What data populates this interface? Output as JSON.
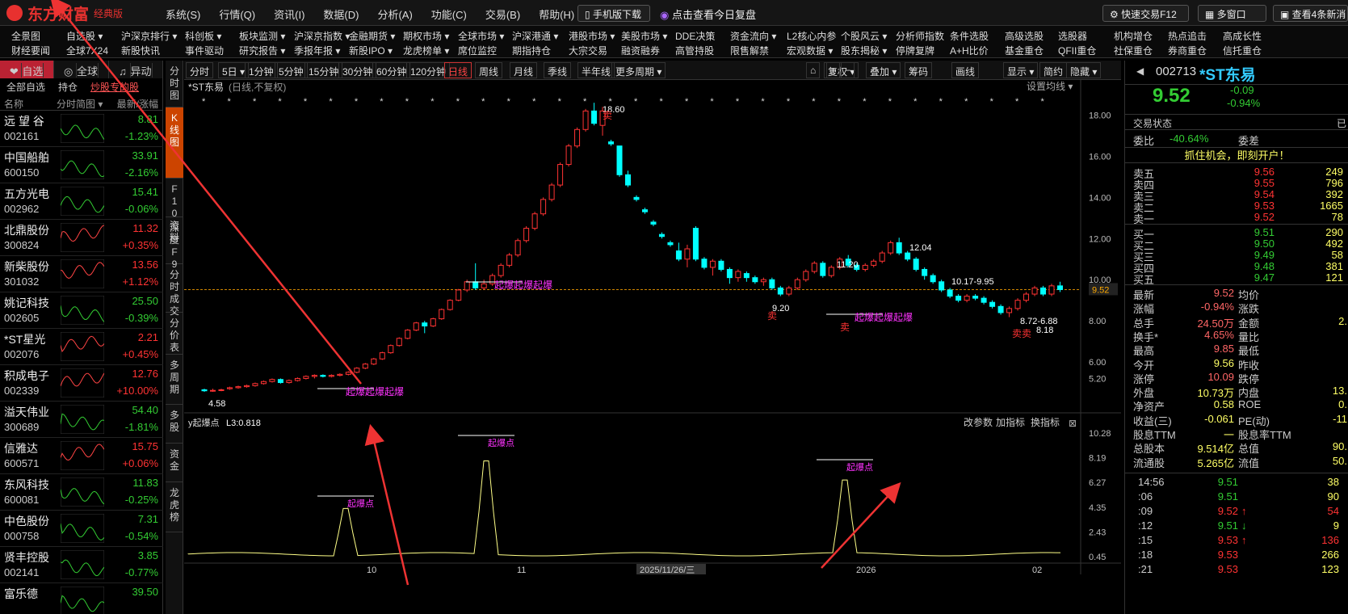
{
  "app": {
    "logo_text": "东方财富",
    "edition": "经典版",
    "menus": [
      "系统(S)",
      "行情(Q)",
      "资讯(I)",
      "数据(D)",
      "分析(A)",
      "功能(C)",
      "交易(B)",
      "帮助(H)"
    ],
    "mobile_download": "手机版下载",
    "review": "点击查看今日复盘",
    "fast_trade": "快速交易F12",
    "multi_window": "多窗口",
    "news_btn": "查看4条新消"
  },
  "menu2": {
    "row1": [
      "全景图",
      "自选股 ▾",
      "沪深京排行 ▾",
      "科创板 ▾",
      "板块监测 ▾",
      "沪深京指数 ▾",
      "金融期货 ▾",
      "期权市场 ▾",
      "全球市场 ▾",
      "沪深港通 ▾",
      "港股市场 ▾",
      "美股市场 ▾",
      "DDE决策",
      "资金流向 ▾",
      "L2核心内参",
      "个股风云 ▾",
      "分析师指数",
      "条件选股",
      "高级选股",
      "选股器",
      "机构增仓",
      "热点追击",
      "高成长性"
    ],
    "row2": [
      "财经要闻",
      "全球7X24",
      "新股快讯",
      "事件驱动",
      "研究报告 ▾",
      "季报年报 ▾",
      "新股IPO ▾",
      "龙虎榜单 ▾",
      "席位监控",
      "期指持仓",
      "大宗交易",
      "融资融券",
      "高管持股",
      "限售解禁",
      "宏观数据 ▾",
      "股东揭秘 ▾",
      "停牌复牌",
      "A+H比价",
      "基金重仓",
      "QFII重仓",
      "社保重仓",
      "券商重仓",
      "信托重仓"
    ]
  },
  "left": {
    "tabs": [
      "自选",
      "全球",
      "异动"
    ],
    "subtabs": [
      "全部自选",
      "持仓",
      "炒股专的股"
    ],
    "head": [
      "名称",
      "分时简图 ▾",
      "最新/涨幅"
    ],
    "stocks": [
      {
        "name": "远 望 谷",
        "code": "002161",
        "price": "8.81",
        "pct": "-1.23%",
        "dir": "dn"
      },
      {
        "name": "中国船舶",
        "code": "600150",
        "price": "33.91",
        "pct": "-2.16%",
        "dir": "dn"
      },
      {
        "name": "五方光电",
        "code": "002962",
        "price": "15.41",
        "pct": "-0.06%",
        "dir": "dn"
      },
      {
        "name": "北鼎股份",
        "code": "300824",
        "price": "11.32",
        "pct": "+0.35%",
        "dir": "up"
      },
      {
        "name": "新柴股份",
        "code": "301032",
        "price": "13.56",
        "pct": "+1.12%",
        "dir": "up"
      },
      {
        "name": "姚记科技",
        "code": "002605",
        "price": "25.50",
        "pct": "-0.39%",
        "dir": "dn"
      },
      {
        "name": "*ST星光",
        "code": "002076",
        "price": "2.21",
        "pct": "+0.45%",
        "dir": "up"
      },
      {
        "name": "积成电子",
        "code": "002339",
        "price": "12.76",
        "pct": "+10.00%",
        "dir": "up"
      },
      {
        "name": "溢天伟业",
        "code": "300689",
        "price": "54.40",
        "pct": "-1.81%",
        "dir": "dn"
      },
      {
        "name": "信雅达",
        "code": "600571",
        "price": "15.75",
        "pct": "+0.06%",
        "dir": "up"
      },
      {
        "name": "东风科技",
        "code": "600081",
        "price": "11.83",
        "pct": "-0.25%",
        "dir": "dn"
      },
      {
        "name": "中色股份",
        "code": "000758",
        "price": "7.31",
        "pct": "-0.54%",
        "dir": "dn"
      },
      {
        "name": "贤丰控股",
        "code": "002141",
        "price": "3.85",
        "pct": "-0.77%",
        "dir": "dn"
      },
      {
        "name": "富乐德",
        "code": "",
        "price": "39.50",
        "pct": "",
        "dir": "dn"
      }
    ]
  },
  "sidetabs": [
    "分时图",
    "K线图",
    "F10资料",
    "深度F9",
    "分时成交",
    "分价表",
    "多周期",
    "多股",
    "资金",
    "龙虎榜"
  ],
  "toolbar": {
    "periods": [
      "分时",
      "5日 ▾",
      "1分钟",
      "5分钟",
      "15分钟",
      "30分钟",
      "60分钟",
      "120分钟",
      "日线",
      "周线",
      "月线",
      "季线",
      "半年线",
      "更多周期 ▾"
    ],
    "tools": [
      "复权 ▾",
      "叠加 ▾",
      "筹码",
      "画线",
      "显示 ▾",
      "简约",
      "隐藏 ▾"
    ]
  },
  "chart_data": {
    "type": "candlestick",
    "title": "*ST东易",
    "subtitle": "(日线,不复权)",
    "set_ma": "设置均线 ▾",
    "ylim": [
      4.0,
      19.0
    ],
    "yticks": [
      "18.00",
      "16.00",
      "14.00",
      "12.00",
      "10.00",
      "8.00",
      "6.00",
      "5.20"
    ],
    "current": "9.52",
    "annotations": [
      "18.60",
      "12.04",
      "11.20",
      "10.17-9.95",
      "9.20",
      "8.72-6.88",
      "8.18",
      "4.58"
    ],
    "signals": [
      "起爆起爆起爆",
      "起爆起爆起爆",
      "起爆起爆起爆"
    ],
    "buy_sell": [
      "卖",
      "卖",
      "卖卖",
      "卖"
    ],
    "candles": [
      [
        4.65,
        4.6,
        4.7,
        4.55
      ],
      [
        4.6,
        4.62,
        4.7,
        4.55
      ],
      [
        4.62,
        4.65,
        4.7,
        4.58
      ],
      [
        4.7,
        4.75,
        4.8,
        4.65
      ],
      [
        4.75,
        4.8,
        4.85,
        4.7
      ],
      [
        4.8,
        4.85,
        4.9,
        4.75
      ],
      [
        4.85,
        4.95,
        5.0,
        4.8
      ],
      [
        4.95,
        5.05,
        5.1,
        4.9
      ],
      [
        5.05,
        5.15,
        5.2,
        5.0
      ],
      [
        5.15,
        5.0,
        5.2,
        4.95
      ],
      [
        5.0,
        5.1,
        5.15,
        4.95
      ],
      [
        5.1,
        5.2,
        5.25,
        5.05
      ],
      [
        5.2,
        5.3,
        5.35,
        5.15
      ],
      [
        5.3,
        5.35,
        5.4,
        5.2
      ],
      [
        5.35,
        5.3,
        5.4,
        5.25
      ],
      [
        5.3,
        5.35,
        5.4,
        5.25
      ],
      [
        5.35,
        5.4,
        5.45,
        5.3
      ],
      [
        5.4,
        5.5,
        5.55,
        5.35
      ],
      [
        5.5,
        5.7,
        5.75,
        5.45
      ],
      [
        5.7,
        5.9,
        5.95,
        5.65
      ],
      [
        5.9,
        6.15,
        6.2,
        5.85
      ],
      [
        6.15,
        6.45,
        6.5,
        6.1
      ],
      [
        6.45,
        6.8,
        6.85,
        6.4
      ],
      [
        6.8,
        7.15,
        7.2,
        6.75
      ],
      [
        7.15,
        7.55,
        7.6,
        7.1
      ],
      [
        7.55,
        7.9,
        7.95,
        7.5
      ],
      [
        7.9,
        7.75,
        8.0,
        7.4
      ],
      [
        7.75,
        8.1,
        8.15,
        7.7
      ],
      [
        8.1,
        8.55,
        8.6,
        8.05
      ],
      [
        8.55,
        9.0,
        9.05,
        8.5
      ],
      [
        9.0,
        9.5,
        9.55,
        8.95
      ],
      [
        9.5,
        9.9,
        10.0,
        9.4
      ],
      [
        9.9,
        9.6,
        10.8,
        9.5
      ],
      [
        9.6,
        9.8,
        10.0,
        9.5
      ],
      [
        9.8,
        10.2,
        10.3,
        9.7
      ],
      [
        10.2,
        10.7,
        10.8,
        10.1
      ],
      [
        10.7,
        11.2,
        11.3,
        10.6
      ],
      [
        11.2,
        11.9,
        12.0,
        11.1
      ],
      [
        11.9,
        12.5,
        12.6,
        11.8
      ],
      [
        12.5,
        13.2,
        13.3,
        12.4
      ],
      [
        13.2,
        13.9,
        14.0,
        13.1
      ],
      [
        13.9,
        14.6,
        14.7,
        13.8
      ],
      [
        14.6,
        15.6,
        15.7,
        14.5
      ],
      [
        15.6,
        16.5,
        16.6,
        15.5
      ],
      [
        16.5,
        17.3,
        17.4,
        16.4
      ],
      [
        17.3,
        18.2,
        18.3,
        17.2
      ],
      [
        18.2,
        17.6,
        18.6,
        17.5
      ],
      [
        17.5,
        18.2,
        18.4,
        17.0
      ],
      [
        16.7,
        16.6,
        16.8,
        16.5
      ],
      [
        16.5,
        15.1,
        16.5,
        15.0
      ],
      [
        15.1,
        14.6,
        15.3,
        14.5
      ],
      [
        14.0,
        13.9,
        14.1,
        13.8
      ],
      [
        13.4,
        13.3,
        13.5,
        13.2
      ],
      [
        12.8,
        12.7,
        12.9,
        12.6
      ],
      [
        12.2,
        12.1,
        12.3,
        12.0
      ],
      [
        11.8,
        11.7,
        11.9,
        11.6
      ],
      [
        11.4,
        11.0,
        11.8,
        10.9
      ],
      [
        11.0,
        11.5,
        11.7,
        10.6
      ],
      [
        12.5,
        11.0,
        12.6,
        10.9
      ],
      [
        11.0,
        10.6,
        11.1,
        10.5
      ],
      [
        10.6,
        10.9,
        11.0,
        10.2
      ],
      [
        10.9,
        10.5,
        11.0,
        10.4
      ],
      [
        10.5,
        10.1,
        10.6,
        9.8
      ],
      [
        10.1,
        10.4,
        10.5,
        9.9
      ],
      [
        10.3,
        10.1,
        10.4,
        9.9
      ],
      [
        10.1,
        9.9,
        10.2,
        9.8
      ],
      [
        9.9,
        10.0,
        10.1,
        9.7
      ],
      [
        10.0,
        9.6,
        10.1,
        9.5
      ],
      [
        9.6,
        9.3,
        9.7,
        9.2
      ],
      [
        9.3,
        9.6,
        9.7,
        9.2
      ],
      [
        9.6,
        10.0,
        10.1,
        9.5
      ],
      [
        10.0,
        10.4,
        10.5,
        9.9
      ],
      [
        10.4,
        10.8,
        10.9,
        10.3
      ],
      [
        10.8,
        10.2,
        10.9,
        10.1
      ],
      [
        10.2,
        10.6,
        10.7,
        10.1
      ],
      [
        10.6,
        11.0,
        11.1,
        10.5
      ],
      [
        11.0,
        10.7,
        11.2,
        10.6
      ],
      [
        10.7,
        10.5,
        10.8,
        10.4
      ],
      [
        10.5,
        10.7,
        10.8,
        10.4
      ],
      [
        10.7,
        10.9,
        11.0,
        10.6
      ],
      [
        10.9,
        11.3,
        11.4,
        10.8
      ],
      [
        11.3,
        11.8,
        11.9,
        11.2
      ],
      [
        11.8,
        11.3,
        12.04,
        11.2
      ],
      [
        11.3,
        11.0,
        11.4,
        10.9
      ],
      [
        11.0,
        10.5,
        11.1,
        10.4
      ],
      [
        10.5,
        10.2,
        10.6,
        10.0
      ],
      [
        10.2,
        9.9,
        10.3,
        9.8
      ],
      [
        9.9,
        9.5,
        10.0,
        9.4
      ],
      [
        9.5,
        9.2,
        9.6,
        9.1
      ],
      [
        9.2,
        9.0,
        9.3,
        8.9
      ],
      [
        9.0,
        9.2,
        9.3,
        8.9
      ],
      [
        9.2,
        9.1,
        9.3,
        9.0
      ],
      [
        9.1,
        8.9,
        9.2,
        8.8
      ],
      [
        8.9,
        8.7,
        9.0,
        8.6
      ],
      [
        8.7,
        8.4,
        8.8,
        8.3
      ],
      [
        8.4,
        8.6,
        8.7,
        8.18
      ],
      [
        8.6,
        9.0,
        9.1,
        8.5
      ],
      [
        9.0,
        9.3,
        9.4,
        8.9
      ],
      [
        9.3,
        9.6,
        9.7,
        9.2
      ],
      [
        9.6,
        9.3,
        9.7,
        9.2
      ],
      [
        9.3,
        9.7,
        9.8,
        9.2
      ],
      [
        9.7,
        9.52,
        9.9,
        9.4
      ]
    ],
    "indicator": {
      "name": "y起爆点",
      "label": "L3:0.818",
      "ticks": [
        "10.28",
        "8.19",
        "6.27",
        "4.35",
        "2.43",
        "0.45"
      ],
      "spike_label": "起爆点",
      "buttons": [
        "改参数",
        "加指标",
        "换指标"
      ]
    },
    "xaxis": [
      "10",
      "11",
      "2025/11/26/三",
      "2026",
      "02"
    ]
  },
  "right": {
    "code": "002713",
    "name": "*ST东易",
    "price": "9.52",
    "chg": "-0.09",
    "pct": "-0.94%",
    "trade_status": "交易状态",
    "weibi_label": "委比",
    "weibi": "-40.64%",
    "weicha_label": "委差",
    "promo": "抓住机会，即刻开户！",
    "asks": [
      [
        "卖五",
        "9.56",
        "249"
      ],
      [
        "卖四",
        "9.55",
        "796"
      ],
      [
        "卖三",
        "9.54",
        "392"
      ],
      [
        "卖二",
        "9.53",
        "1665"
      ],
      [
        "卖一",
        "9.52",
        "78"
      ]
    ],
    "bids": [
      [
        "买一",
        "9.51",
        "290"
      ],
      [
        "买二",
        "9.50",
        "492"
      ],
      [
        "买三",
        "9.49",
        "58"
      ],
      [
        "买四",
        "9.48",
        "381"
      ],
      [
        "买五",
        "9.47",
        "121"
      ]
    ],
    "stats": [
      [
        "最新",
        "9.52",
        "均价",
        ""
      ],
      [
        "涨幅",
        "-0.94%",
        "涨跌",
        ""
      ],
      [
        "总手",
        "24.50万",
        "金额",
        "2."
      ],
      [
        "换手*",
        "4.65%",
        "量比",
        ""
      ],
      [
        "最高",
        "9.85",
        "最低",
        ""
      ],
      [
        "今开",
        "9.56",
        "昨收",
        ""
      ],
      [
        "涨停",
        "10.09",
        "跌停",
        ""
      ],
      [
        "外盘",
        "10.73万",
        "内盘",
        "13."
      ],
      [
        "净资产",
        "0.58",
        "ROE",
        "0."
      ],
      [
        "收益(三)",
        "-0.061",
        "PE(动)",
        "-11"
      ],
      [
        "股息TTM",
        "一",
        "股息率TTM",
        ""
      ],
      [
        "总股本",
        "9.514亿",
        "总值",
        "90."
      ],
      [
        "流通股",
        "5.265亿",
        "流值",
        "50."
      ]
    ],
    "ticks": [
      [
        "14:56",
        "9.51",
        "38",
        ""
      ],
      [
        ":06",
        "9.51",
        "90",
        ""
      ],
      [
        ":09",
        "9.52",
        "54",
        "↑"
      ],
      [
        ":12",
        "9.51",
        "9",
        "↓"
      ],
      [
        ":15",
        "9.53",
        "136",
        "↑"
      ],
      [
        ":18",
        "9.53",
        "266",
        ""
      ],
      [
        ":21",
        "9.53",
        "123",
        ""
      ]
    ]
  }
}
